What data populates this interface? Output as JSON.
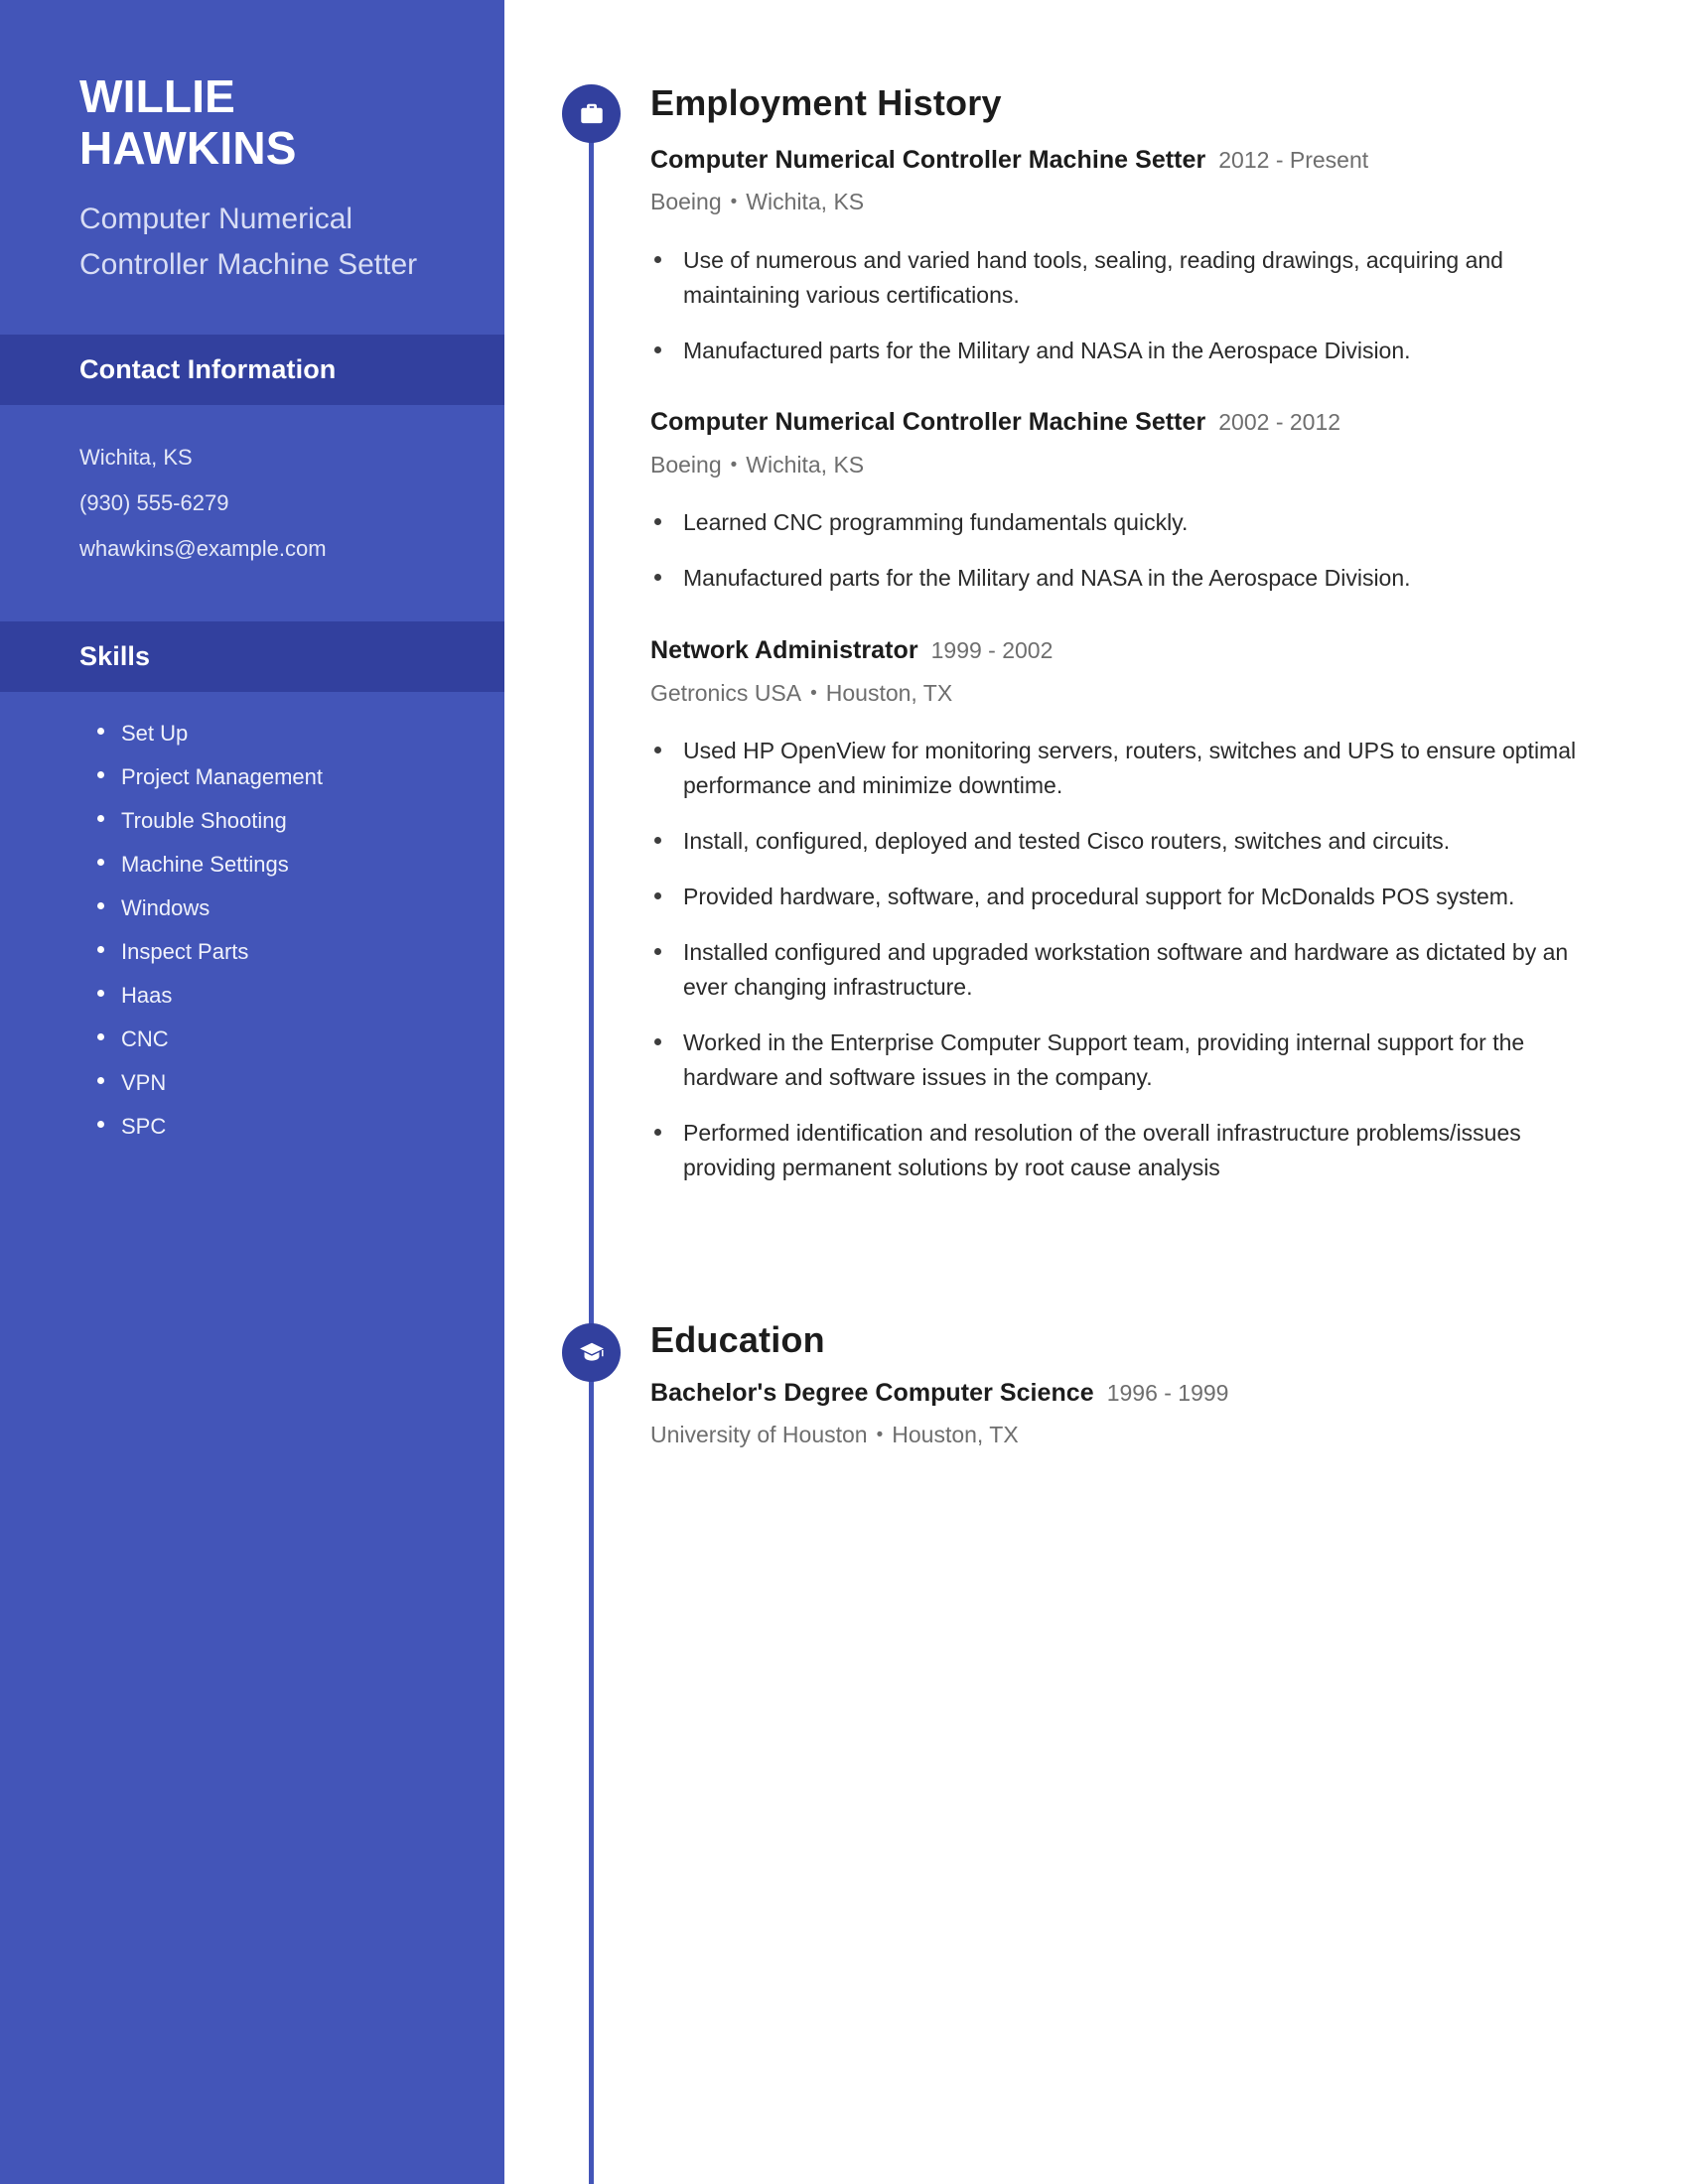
{
  "theme": {
    "sidebar_bg": "#4355b8",
    "sidebar_head_bg": "#32409e",
    "accent": "#32409e",
    "text_dark": "#1c1c1c",
    "text_muted": "#6e6e6e"
  },
  "sidebar": {
    "name_line1": "WILLIE",
    "name_line2": "HAWKINS",
    "job_title": "Computer Numerical Controller Machine Setter",
    "contact": {
      "heading": "Contact Information",
      "lines": [
        "Wichita, KS",
        "(930) 555-6279",
        "whawkins@example.com"
      ]
    },
    "skills": {
      "heading": "Skills",
      "items": [
        "Set Up",
        "Project Management",
        "Trouble Shooting",
        "Machine Settings",
        "Windows",
        "Inspect Parts",
        "Haas",
        "CNC",
        "VPN",
        "SPC"
      ]
    }
  },
  "main": {
    "employment": {
      "heading": "Employment History",
      "icon": "briefcase-icon",
      "entries": [
        {
          "role": "Computer Numerical Controller Machine Setter",
          "dates": "2012 - Present",
          "company": "Boeing",
          "location": "Wichita, KS",
          "bullets": [
            "Use of numerous and varied hand tools, sealing, reading drawings, acquiring and maintaining various certifications.",
            "Manufactured parts for the Military and NASA in the Aerospace Division."
          ]
        },
        {
          "role": "Computer Numerical Controller Machine Setter",
          "dates": "2002 - 2012",
          "company": "Boeing",
          "location": "Wichita, KS",
          "bullets": [
            "Learned CNC programming fundamentals quickly.",
            "Manufactured parts for the Military and NASA in the Aerospace Division."
          ]
        },
        {
          "role": "Network Administrator",
          "dates": "1999 - 2002",
          "company": "Getronics USA",
          "location": "Houston, TX",
          "bullets": [
            "Used HP OpenView for monitoring servers, routers, switches and UPS to ensure optimal performance and minimize downtime.",
            "Install, configured, deployed and tested Cisco routers, switches and circuits.",
            "Provided hardware, software, and procedural support for McDonalds POS system.",
            "Installed configured and upgraded workstation software and hardware as dictated by an ever changing infrastructure.",
            "Worked in the Enterprise Computer Support team, providing internal support for the hardware and software issues in the company.",
            "Performed identification and resolution of the overall infrastructure problems/issues providing permanent solutions by root cause analysis"
          ]
        }
      ]
    },
    "education": {
      "heading": "Education",
      "icon": "graduation-cap-icon",
      "entries": [
        {
          "degree": "Bachelor's Degree Computer Science",
          "dates": "1996 - 1999",
          "school": "University of Houston",
          "location": "Houston, TX"
        }
      ]
    },
    "meta_separator": "•"
  }
}
